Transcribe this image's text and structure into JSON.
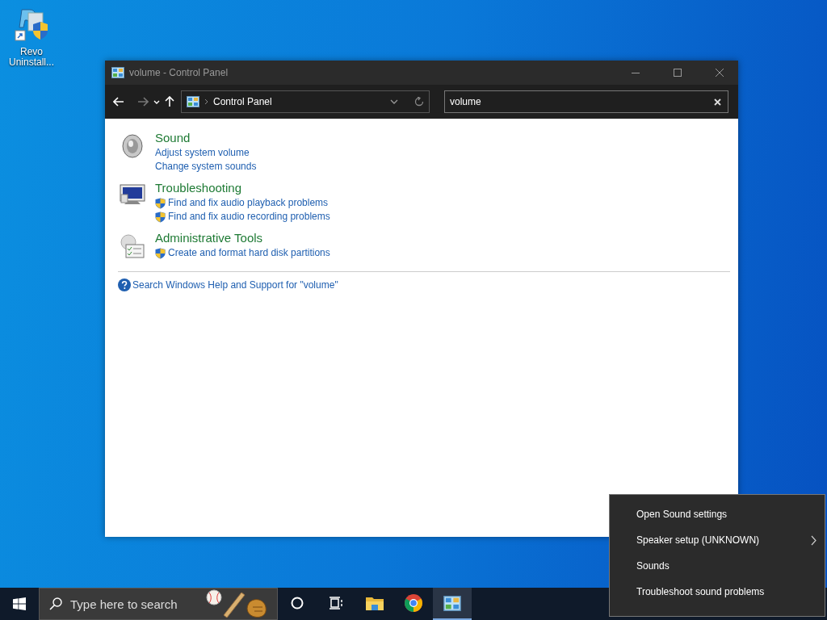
{
  "desktop_icons": [
    {
      "label": "Revo Uninstall..."
    }
  ],
  "window": {
    "title": "volume - Control Panel",
    "address": {
      "breadcrumb": "Control Panel"
    },
    "search": {
      "value": "volume"
    },
    "results": [
      {
        "kind": "sound",
        "title": "Sound",
        "links": [
          {
            "text": "Adjust system volume",
            "shield": false
          },
          {
            "text": "Change system sounds",
            "shield": false
          }
        ]
      },
      {
        "kind": "troubleshooting",
        "title": "Troubleshooting",
        "links": [
          {
            "text": "Find and fix audio playback problems",
            "shield": true
          },
          {
            "text": "Find and fix audio recording problems",
            "shield": true
          }
        ]
      },
      {
        "kind": "admin",
        "title": "Administrative Tools",
        "links": [
          {
            "text": "Create and format hard disk partitions",
            "shield": true
          }
        ]
      }
    ],
    "help_link": "Search Windows Help and Support for \"volume\""
  },
  "taskbar": {
    "search": {
      "placeholder": "Type here to search"
    },
    "apps": [
      {
        "kind": "cortana",
        "selected": false
      },
      {
        "kind": "task-view",
        "selected": false
      },
      {
        "kind": "file-explorer",
        "selected": false
      },
      {
        "kind": "chrome",
        "selected": false
      },
      {
        "kind": "control-panel",
        "selected": true
      }
    ]
  },
  "context_menu": {
    "items": [
      {
        "label": "Open Sound settings",
        "submenu": false
      },
      {
        "label": "Speaker setup (UNKNOWN)",
        "submenu": true
      },
      {
        "label": "Sounds",
        "submenu": false
      },
      {
        "label": "Troubleshoot sound problems",
        "submenu": false
      }
    ]
  }
}
